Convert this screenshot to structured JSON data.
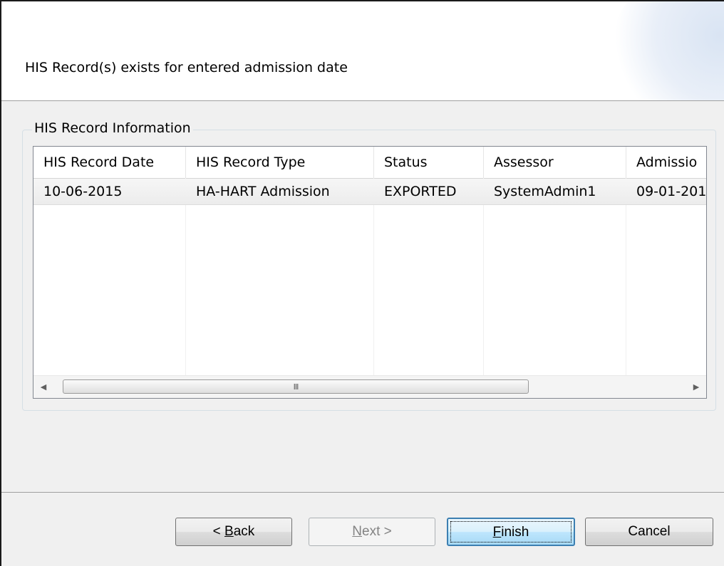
{
  "header": {
    "title": "HIS Record(s) exists for entered admission date"
  },
  "group": {
    "legend": "HIS Record Information"
  },
  "table": {
    "columns": [
      "HIS Record Date",
      "HIS Record Type",
      "Status",
      "Assessor",
      "Admissio"
    ],
    "rows": [
      [
        "10-06-2015",
        "HA-HART Admission",
        "EXPORTED",
        "SystemAdmin1",
        "09-01-201"
      ]
    ]
  },
  "scrollbar": {
    "left_arrow": "◀",
    "right_arrow": "▶",
    "grip": "III"
  },
  "buttons": {
    "back": {
      "accel": "B",
      "pre": "< ",
      "rest": "ack"
    },
    "next": {
      "accel": "N",
      "pre": "",
      "rest": "ext >"
    },
    "finish": {
      "accel": "F",
      "pre": "",
      "rest": "inish"
    },
    "cancel": {
      "label": "Cancel"
    }
  }
}
